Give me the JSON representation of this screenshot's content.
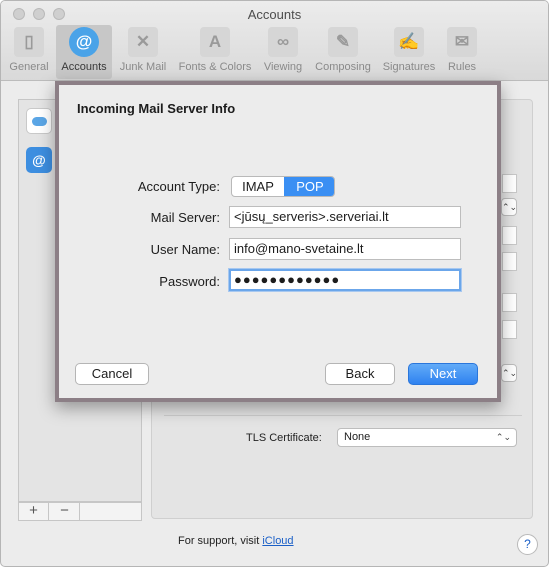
{
  "window": {
    "title": "Accounts"
  },
  "toolbar": {
    "items": [
      {
        "label": "General",
        "icon": "general-icon",
        "glyph": "▯"
      },
      {
        "label": "Accounts",
        "icon": "at-sign-icon",
        "glyph": "@"
      },
      {
        "label": "Junk Mail",
        "icon": "junk-mail-icon",
        "glyph": "✕"
      },
      {
        "label": "Fonts & Colors",
        "icon": "fonts-colors-icon",
        "glyph": "A"
      },
      {
        "label": "Viewing",
        "icon": "glasses-icon",
        "glyph": "∞"
      },
      {
        "label": "Composing",
        "icon": "pencil-icon",
        "glyph": "✎"
      },
      {
        "label": "Signatures",
        "icon": "signature-icon",
        "glyph": "✍"
      },
      {
        "label": "Rules",
        "icon": "rules-icon",
        "glyph": "✉"
      }
    ],
    "selected": "Accounts"
  },
  "sidebar": {
    "accounts": [
      {
        "icon": "icloud-icon"
      },
      {
        "icon": "mail-at-icon",
        "glyph": "@"
      }
    ],
    "add_glyph": "+",
    "remove_glyph": "−"
  },
  "pane": {
    "tls_label": "TLS Certificate:",
    "tls_value": "None",
    "select_arrows": "⌃⌄"
  },
  "footer": {
    "support_text": "For support, visit ",
    "support_link": "iCloud",
    "help_glyph": "?"
  },
  "dialog": {
    "title": "Incoming Mail Server Info",
    "account_type_label": "Account Type:",
    "account_type_options": [
      "IMAP",
      "POP"
    ],
    "account_type_selected": "POP",
    "mail_server_label": "Mail Server:",
    "mail_server_value": "<jūsų_serveris>.serveriai.lt",
    "user_name_label": "User Name:",
    "user_name_value": "info@mano-svetaine.lt",
    "password_label": "Password:",
    "password_value": "●●●●●●●●●●●●",
    "cancel_label": "Cancel",
    "back_label": "Back",
    "next_label": "Next"
  },
  "colors": {
    "accent": "#3a8ff3",
    "dialog_border": "#8c7f86",
    "link": "#1a5fc7"
  }
}
